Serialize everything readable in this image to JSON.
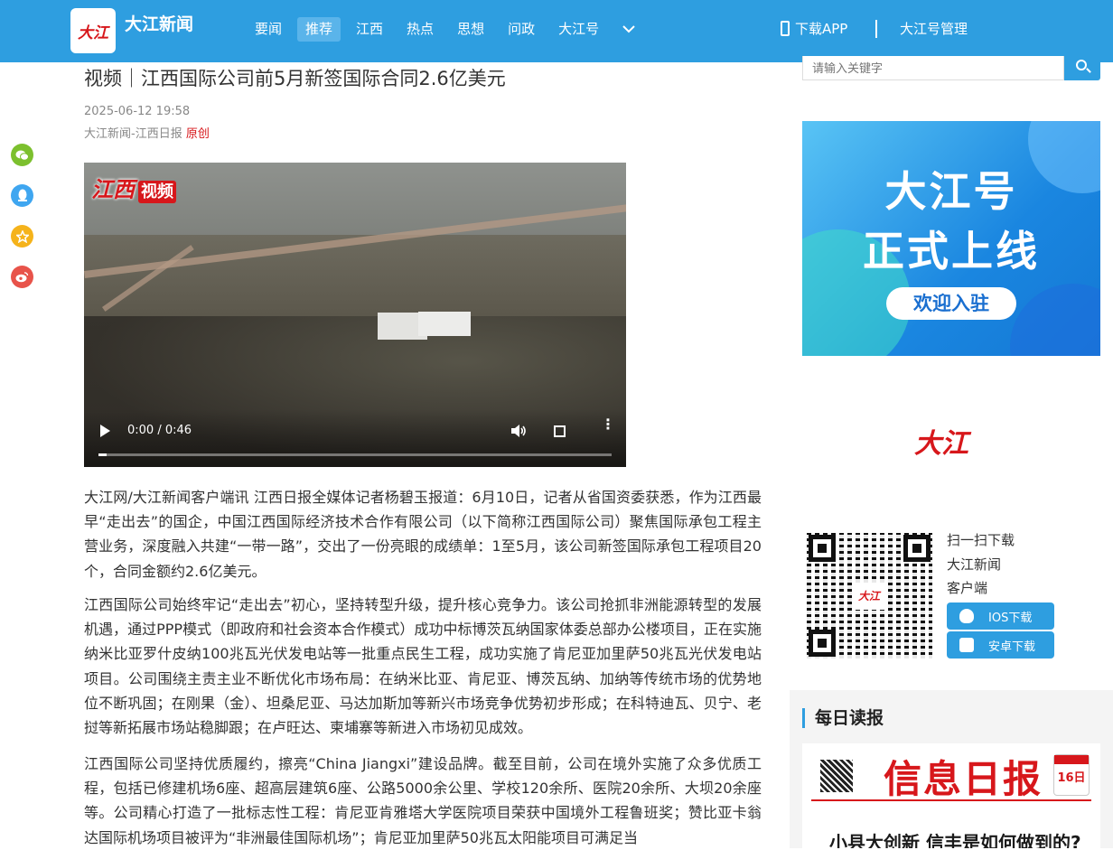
{
  "header": {
    "logo_text": "大江",
    "site_name": "大江新闻",
    "nav": [
      "要闻",
      "推荐",
      "江西",
      "热点",
      "思想",
      "问政",
      "大江号"
    ],
    "active_nav": "推荐",
    "more_icon": "chevron-down-icon",
    "download_app": "下载APP",
    "djh_manage": "大江号管理"
  },
  "article": {
    "title": "视频｜江西国际公司前5月新签国际合同2.6亿美元",
    "date": "2025-06-12 19:58",
    "source": "大江新闻-江西日报",
    "original_tag": "原创",
    "video": {
      "watermark_brand": "江西",
      "watermark_tag": "视频",
      "time": "0:00 / 0:46",
      "progress": 0.0
    },
    "paragraphs": [
      "大江网/大江新闻客户端讯 江西日报全媒体记者杨碧玉报道：6月10日，记者从省国资委获悉，作为江西最早“走出去”的国企，中国江西国际经济技术合作有限公司（以下简称江西国际公司）聚焦国际承包工程主营业务，深度融入共建“一带一路”，交出了一份亮眼的成绩单：1至5月，该公司新签国际承包工程项目20个，合同金额约2.6亿美元。",
      "江西国际公司始终牢记“走出去”初心，坚持转型升级，提升核心竞争力。该公司抢抓非洲能源转型的发展机遇，通过PPP模式（即政府和社会资本合作模式）成功中标博茨瓦纳国家体委总部办公楼项目，正在实施纳米比亚罗什皮纳100兆瓦光伏发电站等一批重点民生工程，成功实施了肯尼亚加里萨50兆瓦光伏发电站项目。公司围绕主责主业不断优化市场布局：在纳米比亚、肯尼亚、博茨瓦纳、加纳等传统市场的优势地位不断巩固；在刚果（金）、坦桑尼亚、马达加斯加等新兴市场竞争优势初步形成；在科特迪瓦、贝宁、老挝等新拓展市场站稳脚跟；在卢旺达、柬埔寨等新进入市场初见成效。",
      "江西国际公司坚持优质履约，擦亮“China Jiangxi”建设品牌。截至目前，公司在境外实施了众多优质工程，包括已修建机场6座、超高层建筑6座、公路5000余公里、学校120余所、医院20余所、大坝20余座等。公司精心打造了一批标志性工程：肯尼亚肯雅塔大学医院项目荣获中国境外工程鲁班奖；赞比亚卡翁达国际机场项目被评为“非洲最佳国际机场”；肯尼亚加里萨50兆瓦太阳能项目可满足当"
    ]
  },
  "share_icons": [
    {
      "name": "wechat-icon",
      "color": "#7cc02e",
      "glyph": "◉"
    },
    {
      "name": "qq-icon",
      "color": "#3fa6f0",
      "glyph": "●"
    },
    {
      "name": "qzone-icon",
      "color": "#f5b31b",
      "glyph": "★"
    },
    {
      "name": "weibo-icon",
      "color": "#e8534a",
      "glyph": "◎"
    }
  ],
  "sidebar": {
    "search_placeholder": "请输入关键字",
    "banner": {
      "line1": "大江号",
      "line2": "正式上线",
      "button": "欢迎入驻"
    },
    "logo": "大江",
    "qr_center": "大江",
    "qr_text": [
      "扫一扫下载",
      "大江新闻",
      "客户端"
    ],
    "ios_button": "IOS下载",
    "android_button": "安卓下载",
    "daily_title": "每日读报",
    "paper_masthead": "信息日报",
    "paper_date": "16日",
    "paper_headline": "小县大创新 信丰是如何做到的?"
  },
  "colors": {
    "header_bg": "#2e9ee0",
    "accent_red": "#d7171b"
  }
}
